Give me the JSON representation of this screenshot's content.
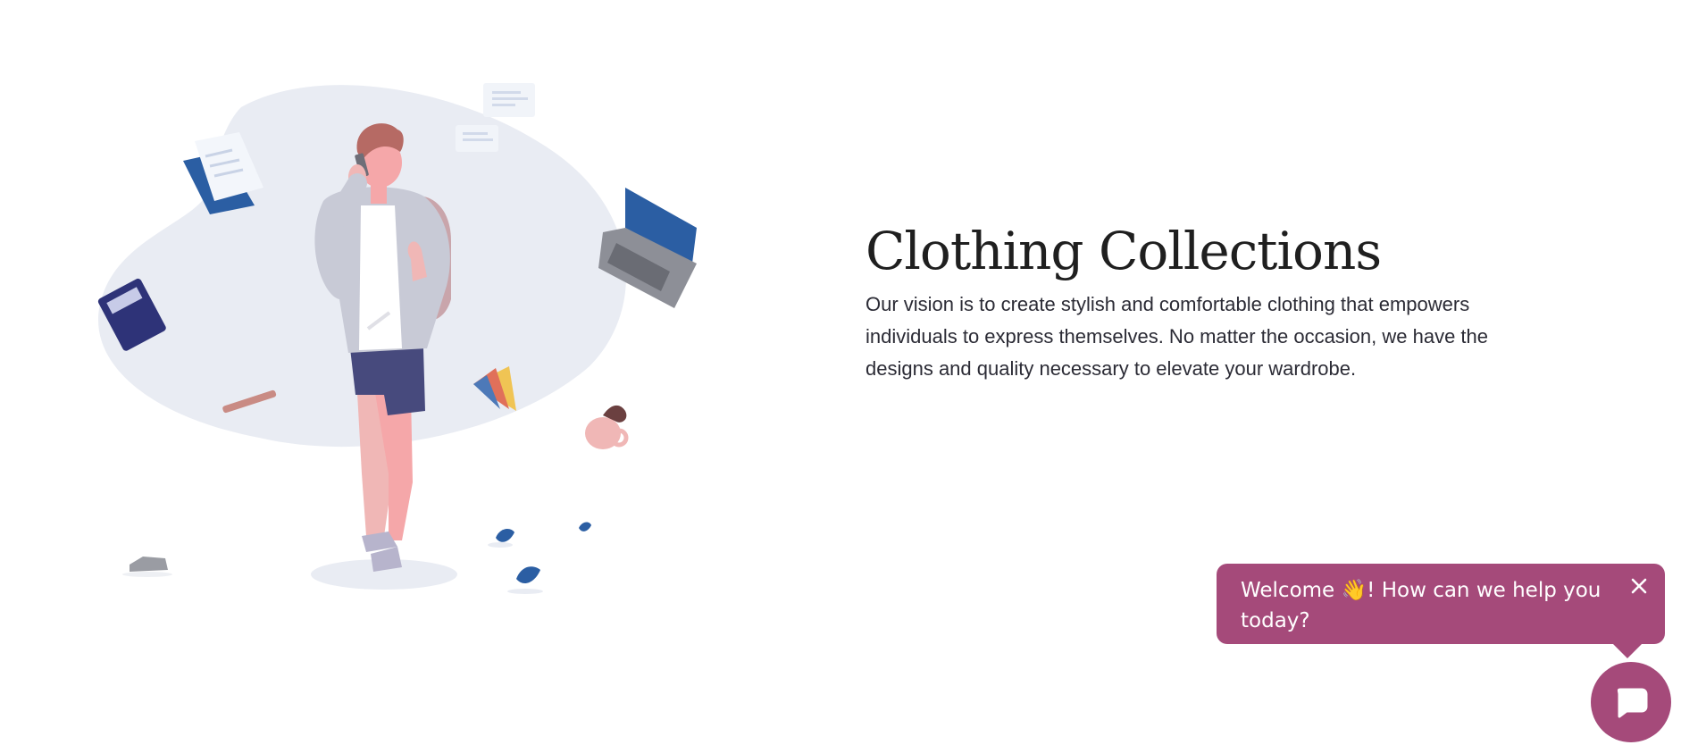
{
  "hero": {
    "title": "Clothing Collections",
    "description": "Our vision is to create stylish and comfortable clothing that empowers individuals to express themselves. No matter the occasion, we have the designs and quality necessary to elevate your wardrobe.",
    "illustration_icon": "person-on-phone-illustration"
  },
  "chat": {
    "welcome_prefix": "Welcome ",
    "wave_emoji": "👋",
    "welcome_suffix": "! How can we help you today?",
    "close_icon": "close-icon",
    "launcher_icon": "chat-bubble-icon"
  },
  "colors": {
    "accent": "#a54a7a",
    "title_text": "#1f1f1f",
    "body_text": "#2b2b35",
    "blob": "#e9ecf3",
    "navy": "#2c3f8c"
  }
}
